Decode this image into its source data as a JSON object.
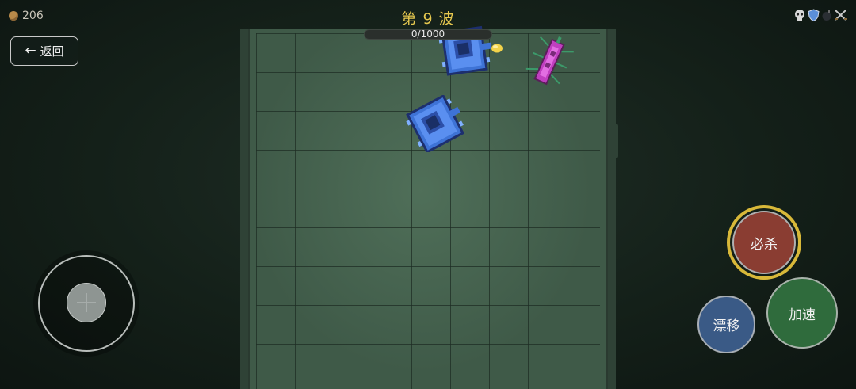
{
  "hud": {
    "coins": "206",
    "back_label": "返回",
    "wave_title": "第 9 波",
    "progress_text": "0/1000",
    "progress_fraction": 0.0,
    "status_icons": [
      "skull-icon",
      "shield-icon",
      "bomb-icon",
      "crossed-swords-icon"
    ]
  },
  "arena": {
    "enemies": [
      "blue-tank-enemy",
      "blue-tank-enemy",
      "pink-bug-enemy"
    ],
    "pickup": "gold-coin-pickup"
  },
  "controls": {
    "ultimate_label": "必杀",
    "drift_label": "漂移",
    "boost_label": "加速"
  },
  "colors": {
    "wave_text": "#e6c84f",
    "ultimate": "#8a3d32",
    "ultimate_ring": "#d8b839",
    "drift": "#3a5a86",
    "boost": "#2f6b3c"
  }
}
